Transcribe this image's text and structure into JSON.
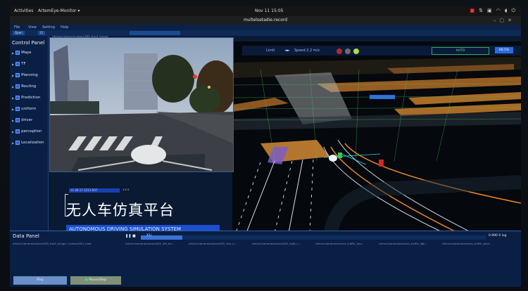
{
  "topbar": {
    "activities": "Activities",
    "app_menu": "ArtemEye-Monitor ▾",
    "clock": "Nov 11  15:05"
  },
  "window": {
    "title": "multelsetadie.record"
  },
  "menubar": {
    "items": [
      "File",
      "View",
      "Setting",
      "Help"
    ]
  },
  "toolbar": {
    "buttons": [
      "Open",
      "Cl"
    ]
  },
  "control_panel": {
    "title": "Control Panel",
    "items": [
      {
        "label": "Maps"
      },
      {
        "label": "TF"
      },
      {
        "label": "Planning"
      },
      {
        "label": "Routing"
      },
      {
        "label": "Prediction"
      },
      {
        "label": "uniform"
      },
      {
        "label": "driver"
      },
      {
        "label": "perception"
      },
      {
        "label": "Localization"
      }
    ]
  },
  "camera": {
    "title": "/driver/camera/camera300_front_image"
  },
  "hud": {
    "limit": "Limit",
    "speed": "Speed 2.2 m/s",
    "mode": "AUTO",
    "percent": "88.5%"
  },
  "overlay": {
    "timestamp": "11.00.17 2213 N37",
    "timestamp_right": "1.5 V",
    "headline_zh": "无人车仿真平台",
    "headline_en": "AUTONOMOUS DRIVING SIMULATION SYSTEM"
  },
  "data_panel": {
    "title": "Data Panel",
    "path": "/driver/camera/camera300_front_image | camera300_front",
    "rate": "0.990 0   log",
    "speed_label": "X1/",
    "streams": [
      "/driver/camera/camera300_left_im...",
      "/driver/camera/camera300_rear_ri...",
      "/driver/camera/camera300_right_c...",
      "/driver/camera/camera_traffic_ima...",
      "/driver/camera/camera_traffic_ligh...",
      "/driver/camera/camera_traffic_phot..."
    ],
    "progress": 0.12,
    "btn_left": "Play",
    "btn_right": "Pause/Stop"
  }
}
